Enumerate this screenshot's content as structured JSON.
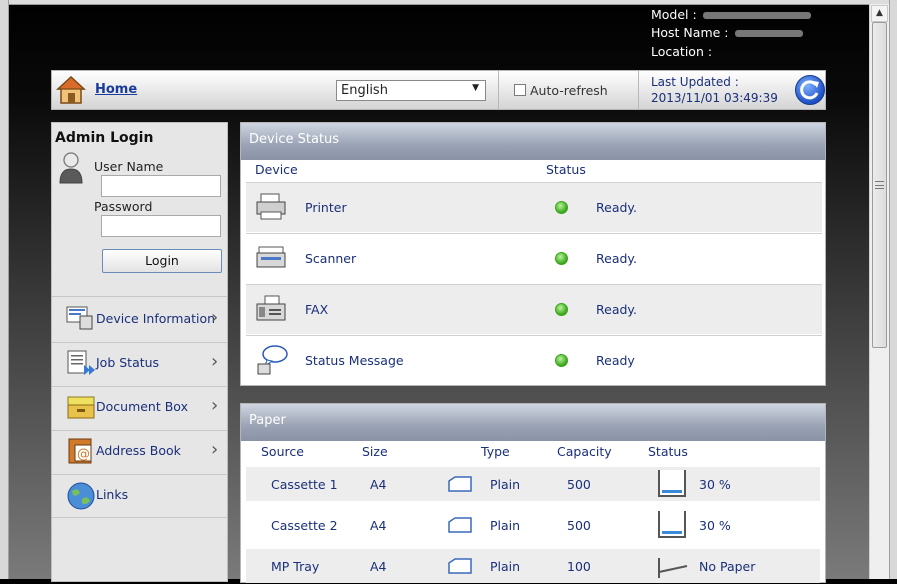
{
  "header": {
    "model_label": "Model :",
    "hostname_label": "Host Name :",
    "location_label": "Location :"
  },
  "topbar": {
    "home_label": "Home",
    "language": "English",
    "autorefresh_label": "Auto-refresh",
    "last_updated_label": "Last Updated :",
    "last_updated_value": "2013/11/01 03:49:39"
  },
  "sidebar": {
    "admin_title": "Admin Login",
    "username_label": "User Name",
    "password_label": "Password",
    "login_label": "Login",
    "items": [
      {
        "label": "Device Information"
      },
      {
        "label": "Job Status"
      },
      {
        "label": "Document Box"
      },
      {
        "label": "Address Book"
      },
      {
        "label": "Links"
      }
    ]
  },
  "device_status": {
    "title": "Device Status",
    "col_device": "Device",
    "col_status": "Status",
    "rows": [
      {
        "device": "Printer",
        "status": "Ready.",
        "status_color": "#3aa51c"
      },
      {
        "device": "Scanner",
        "status": "Ready.",
        "status_color": "#3aa51c"
      },
      {
        "device": "FAX",
        "status": "Ready.",
        "status_color": "#3aa51c"
      },
      {
        "device": "Status Message",
        "status": "Ready",
        "status_color": "#3aa51c"
      }
    ]
  },
  "paper": {
    "title": "Paper",
    "col_source": "Source",
    "col_size": "Size",
    "col_type": "Type",
    "col_capacity": "Capacity",
    "col_status": "Status",
    "rows": [
      {
        "source": "Cassette 1",
        "size": "A4",
        "type": "Plain",
        "capacity": "500",
        "status": "30 %",
        "level": 0.3
      },
      {
        "source": "Cassette 2",
        "size": "A4",
        "type": "Plain",
        "capacity": "500",
        "status": "30 %",
        "level": 0.3
      },
      {
        "source": "MP Tray",
        "size": "A4",
        "type": "Plain",
        "capacity": "100",
        "status": "No Paper",
        "level": 0
      }
    ]
  }
}
